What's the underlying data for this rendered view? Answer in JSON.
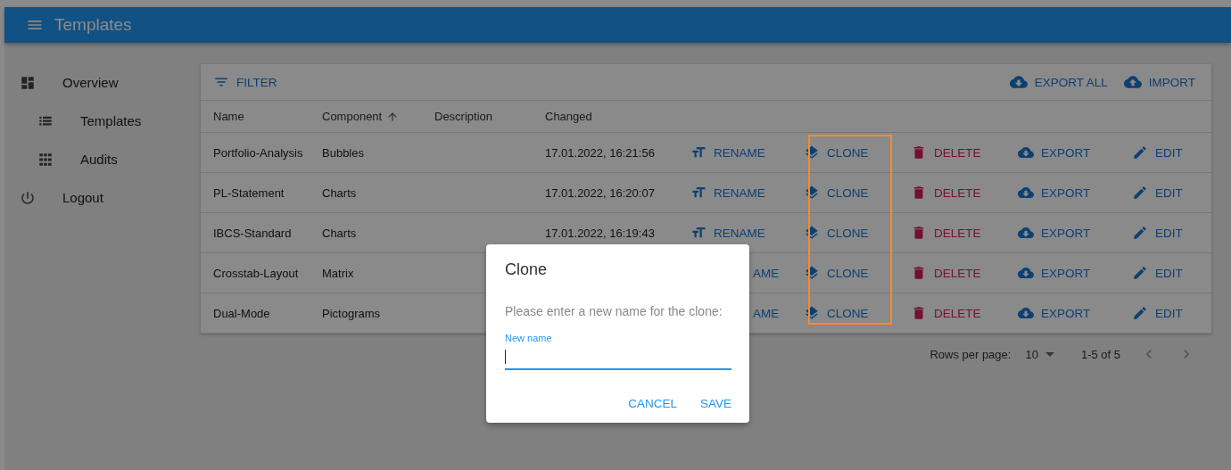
{
  "app_bar": {
    "title": "Templates"
  },
  "sidebar": {
    "items": [
      {
        "label": "Overview",
        "kind": "dashboard",
        "children": [
          {
            "label": "Templates",
            "kind": "list"
          },
          {
            "label": "Audits",
            "kind": "grid"
          }
        ]
      },
      {
        "label": "Logout",
        "kind": "power"
      }
    ]
  },
  "toolbar": {
    "filter": "FILTER",
    "actions": [
      {
        "label": "EXPORT ALL",
        "kind": "download"
      },
      {
        "label": "IMPORT",
        "kind": "upload"
      }
    ]
  },
  "table": {
    "columns": [
      {
        "label": "Name"
      },
      {
        "label": "Component",
        "sorted_ascending": true
      },
      {
        "label": "Description"
      },
      {
        "label": "Changed"
      }
    ],
    "rows": [
      {
        "name": "Portfolio-Analysis",
        "component": "Bubbles",
        "changed": "17.01.2022, 16:21:56",
        "actions": [
          {
            "kind": "rename",
            "label": "RENAME"
          },
          {
            "kind": "clone",
            "label": "CLONE"
          },
          {
            "kind": "delete",
            "label": "DELETE"
          },
          {
            "kind": "export",
            "label": "EXPORT"
          },
          {
            "kind": "edit",
            "label": "EDIT"
          }
        ]
      },
      {
        "name": "PL-Statement",
        "component": "Charts",
        "changed": "17.01.2022, 16:20:07",
        "actions": [
          {
            "kind": "rename",
            "label": "RENAME"
          },
          {
            "kind": "clone",
            "label": "CLONE"
          },
          {
            "kind": "delete",
            "label": "DELETE"
          },
          {
            "kind": "export",
            "label": "EXPORT"
          },
          {
            "kind": "edit",
            "label": "EDIT"
          }
        ]
      },
      {
        "name": "IBCS-Standard",
        "component": "Charts",
        "changed": "17.01.2022, 16:19:43",
        "actions": [
          {
            "kind": "rename",
            "label": "RENAME"
          },
          {
            "kind": "clone",
            "label": "CLONE"
          },
          {
            "kind": "delete",
            "label": "DELETE"
          },
          {
            "kind": "export",
            "label": "EXPORT"
          },
          {
            "kind": "edit",
            "label": "EDIT"
          }
        ]
      },
      {
        "name": "Crosstab-Layout",
        "component": "Matrix",
        "actions": [
          {
            "kind": "rename_cut",
            "label": "AME"
          },
          {
            "kind": "clone",
            "label": "CLONE"
          },
          {
            "kind": "delete",
            "label": "DELETE"
          },
          {
            "kind": "export",
            "label": "EXPORT"
          },
          {
            "kind": "edit",
            "label": "EDIT"
          }
        ]
      },
      {
        "name": "Dual-Mode",
        "component": "Pictograms",
        "actions": [
          {
            "kind": "rename_cut",
            "label": "AME"
          },
          {
            "kind": "clone",
            "label": "CLONE"
          },
          {
            "kind": "delete",
            "label": "DELETE"
          },
          {
            "kind": "export",
            "label": "EXPORT"
          },
          {
            "kind": "edit",
            "label": "EDIT"
          }
        ]
      }
    ]
  },
  "pagination": {
    "rows_per_page_label": "Rows per page:",
    "rows_per_page": "10",
    "range": "1-5 of 5"
  },
  "highlight_frame": true,
  "dialog": {
    "title": "Clone",
    "message": "Please enter a new name for the clone:",
    "field": {
      "label": "New name",
      "focused": true
    },
    "buttons": [
      "CANCEL",
      "SAVE"
    ]
  }
}
